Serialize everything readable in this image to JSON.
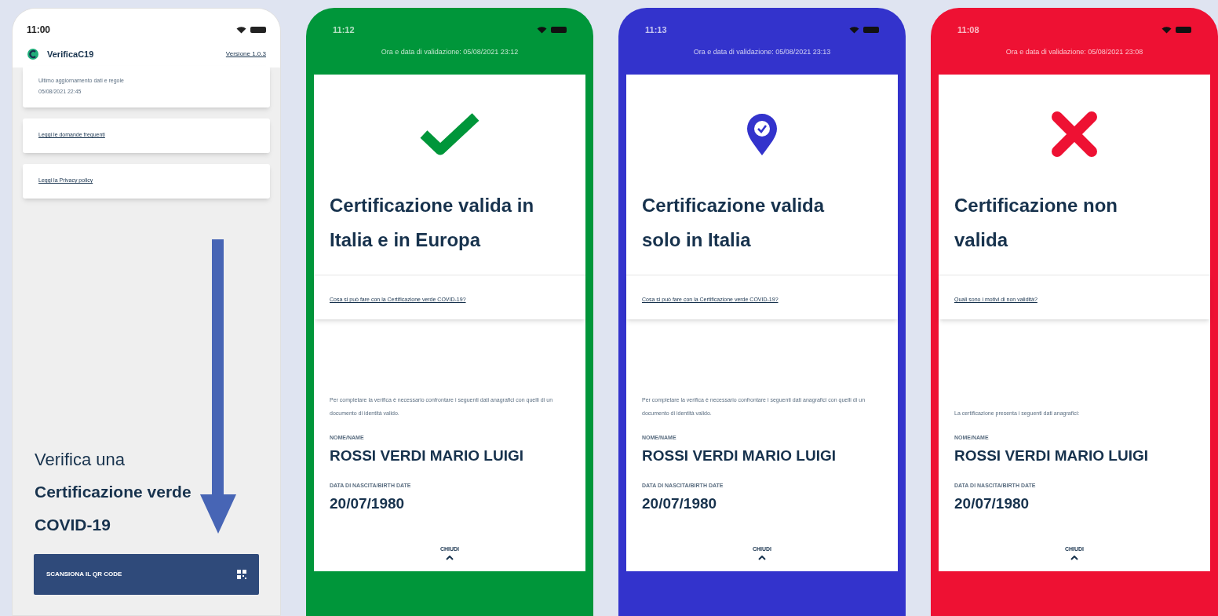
{
  "home": {
    "time": "11:00",
    "app_name": "VerificaC19",
    "version": "Versione 1.0.3",
    "update_card": {
      "label": "Ultimo aggiornamento dati e regole",
      "date": "05/08/2021 22:45"
    },
    "links": [
      "Leggi le domande frequenti",
      "Leggi la Privacy policy"
    ],
    "headline": {
      "intro": "Verifica una",
      "title": "Certificazione verde COVID-19"
    },
    "scan_button": "SCANSIONA IL QR CODE"
  },
  "results": [
    {
      "kind": "check",
      "color": "#00963a",
      "time": "11:12",
      "validation": "Ora e data di validazione: 05/08/2021 23:12",
      "title": "Certificazione valida in Italia e in Europa",
      "link": "Cosa si può fare con la Certificazione verde COVID-19?",
      "instructions": "Per completare la verifica è necessario confrontare i seguenti dati anagrafici con quelli di un documento di identità valido.",
      "name_label": "NOME/NAME",
      "name": "ROSSI VERDI MARIO LUIGI",
      "birth_label": "DATA DI NASCITA/BIRTH DATE",
      "birth": "20/07/1980",
      "close": "CHIUDI"
    },
    {
      "kind": "pin",
      "color": "#3333cc",
      "time": "11:13",
      "validation": "Ora e data di validazione: 05/08/2021 23:13",
      "title": "Certificazione valida solo in Italia",
      "link": "Cosa si può fare con la Certificazione verde COVID-19?",
      "instructions": "Per completare la verifica è necessario confrontare i seguenti dati anagrafici con quelli di un documento di identità valido.",
      "name_label": "NOME/NAME",
      "name": "ROSSI VERDI MARIO LUIGI",
      "birth_label": "DATA DI NASCITA/BIRTH DATE",
      "birth": "20/07/1980",
      "close": "CHIUDI"
    },
    {
      "kind": "cross",
      "color": "#ee1133",
      "time": "11:08",
      "validation": "Ora e data di validazione: 05/08/2021 23:08",
      "title": "Certificazione non valida",
      "link": "Quali sono i motivi di non validità?",
      "instructions": "La certificazione presenta i seguenti dati anagrafici:",
      "name_label": "NOME/NAME",
      "name": "ROSSI VERDI MARIO LUIGI",
      "birth_label": "DATA DI NASCITA/BIRTH DATE",
      "birth": "20/07/1980",
      "close": "CHIUDI"
    }
  ]
}
